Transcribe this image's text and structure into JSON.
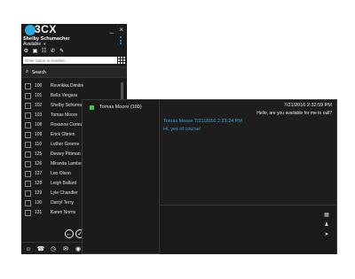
{
  "app": {
    "logo_text": "3CX"
  },
  "window_controls": {
    "minimize": "_",
    "close": "×"
  },
  "user": {
    "name": "Shelby Schumacher",
    "status": "Available",
    "status_caret": "▼"
  },
  "search": {
    "placeholder": "Enter name or number...",
    "label": "Search"
  },
  "contacts": [
    {
      "ext": "100",
      "name": "Reveikka Dimitriou"
    },
    {
      "ext": "101",
      "name": "Bella Vergara"
    },
    {
      "ext": "102",
      "name": "Shelby Schumacher"
    },
    {
      "ext": "103",
      "name": "Tomas Moore"
    },
    {
      "ext": "108",
      "name": "Roxanne Cortez"
    },
    {
      "ext": "109",
      "name": "Erick Obrien"
    },
    {
      "ext": "110",
      "name": "Luther Greene"
    },
    {
      "ext": "125",
      "name": "Dewey Pittman"
    },
    {
      "ext": "126",
      "name": "Miranda Lambert"
    },
    {
      "ext": "127",
      "name": "Leo Olson"
    },
    {
      "ext": "128",
      "name": "Leigh Ballard"
    },
    {
      "ext": "129",
      "name": "Lyle Chandler"
    },
    {
      "ext": "130",
      "name": "Darryl Terry"
    },
    {
      "ext": "131",
      "name": "Karen Norris"
    }
  ],
  "chat": {
    "conversation_label": "Tomas Moore (103)",
    "timestamp": "7/21/2016 2:32:59 PM",
    "outgoing_message": "Hello, are you available for me to call?",
    "reply_header": "Tomas Moore 7/21/2016 2:33:24 PM",
    "reply_text": "Hi, yes of course!"
  },
  "colors": {
    "accent": "#2aa8e0",
    "reply_text": "#3aa3dd",
    "presence_green": "#2ecc40",
    "panel_bg": "#1b1b1b"
  }
}
